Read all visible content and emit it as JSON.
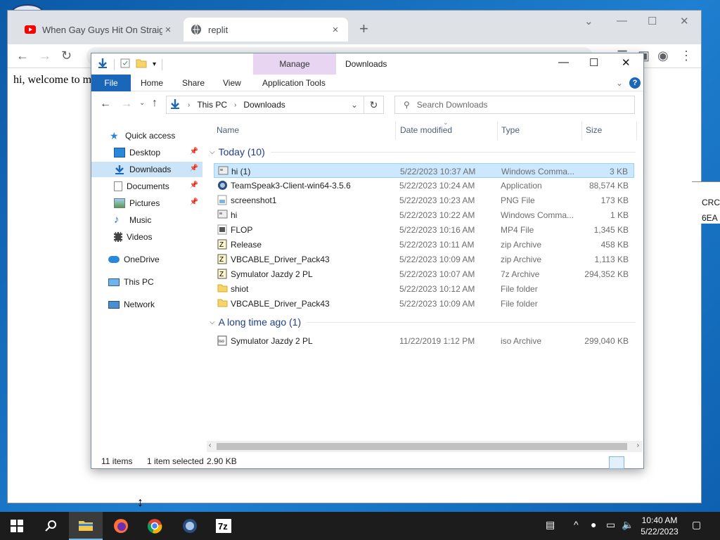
{
  "browser": {
    "tabs": [
      {
        "title": "When Gay Guys Hit On Straight",
        "close": "×"
      },
      {
        "title": "replit",
        "close": "×"
      }
    ],
    "new_tab": "+",
    "page_text": "hi, welcome to m",
    "side_text_1": "CRC",
    "side_text_2": "6EA"
  },
  "explorer": {
    "window_title": "Downloads",
    "contextual_group": "Manage",
    "ribbon_tabs": {
      "file": "File",
      "home": "Home",
      "share": "Share",
      "view": "View",
      "app_tools": "Application Tools"
    },
    "breadcrumb": {
      "root": "This PC",
      "current": "Downloads"
    },
    "search_placeholder": "Search Downloads",
    "nav": {
      "quick_access": "Quick access",
      "desktop": "Desktop",
      "downloads": "Downloads",
      "documents": "Documents",
      "pictures": "Pictures",
      "music": "Music",
      "videos": "Videos",
      "onedrive": "OneDrive",
      "this_pc": "This PC",
      "network": "Network"
    },
    "columns": {
      "name": "Name",
      "date": "Date modified",
      "type": "Type",
      "size": "Size"
    },
    "groups": {
      "today": "Today (10)",
      "long_ago": "A long time ago (1)"
    },
    "files": [
      {
        "name": "hi (1)",
        "date": "5/22/2023 10:37 AM",
        "type": "Windows Comma...",
        "size": "3 KB",
        "icon": "cmd-icon"
      },
      {
        "name": "TeamSpeak3-Client-win64-3.5.6",
        "date": "5/22/2023 10:24 AM",
        "type": "Application",
        "size": "88,574 KB",
        "icon": "app-icon"
      },
      {
        "name": "screenshot1",
        "date": "5/22/2023 10:23 AM",
        "type": "PNG File",
        "size": "173 KB",
        "icon": "image-icon"
      },
      {
        "name": "hi",
        "date": "5/22/2023 10:22 AM",
        "type": "Windows Comma...",
        "size": "1 KB",
        "icon": "cmd-icon"
      },
      {
        "name": "FLOP",
        "date": "5/22/2023 10:16 AM",
        "type": "MP4 File",
        "size": "1,345 KB",
        "icon": "video-icon"
      },
      {
        "name": "Release",
        "date": "5/22/2023 10:11 AM",
        "type": "zip Archive",
        "size": "458 KB",
        "icon": "archive-icon"
      },
      {
        "name": "VBCABLE_Driver_Pack43",
        "date": "5/22/2023 10:09 AM",
        "type": "zip Archive",
        "size": "1,113 KB",
        "icon": "archive-icon"
      },
      {
        "name": "Symulator Jazdy 2 PL",
        "date": "5/22/2023 10:07 AM",
        "type": "7z Archive",
        "size": "294,352 KB",
        "icon": "archive-icon"
      },
      {
        "name": "shiot",
        "date": "5/22/2023 10:12 AM",
        "type": "File folder",
        "size": "",
        "icon": "folder-icon"
      },
      {
        "name": "VBCABLE_Driver_Pack43",
        "date": "5/22/2023 10:09 AM",
        "type": "File folder",
        "size": "",
        "icon": "folder-icon"
      }
    ],
    "old_files": [
      {
        "name": "Symulator Jazdy 2 PL",
        "date": "11/22/2019 1:12 PM",
        "type": "iso Archive",
        "size": "299,040 KB",
        "icon": "iso-icon"
      }
    ],
    "status": {
      "count": "11 items",
      "selected": "1 item selected",
      "size": "2.90 KB"
    }
  },
  "taskbar": {
    "time": "10:40 AM",
    "date": "5/22/2023"
  },
  "colors": {
    "accent": "#1a66b8",
    "selection": "#cce8ff",
    "manage": "#e7d5f2",
    "taskbar": "#1c1c1c"
  }
}
